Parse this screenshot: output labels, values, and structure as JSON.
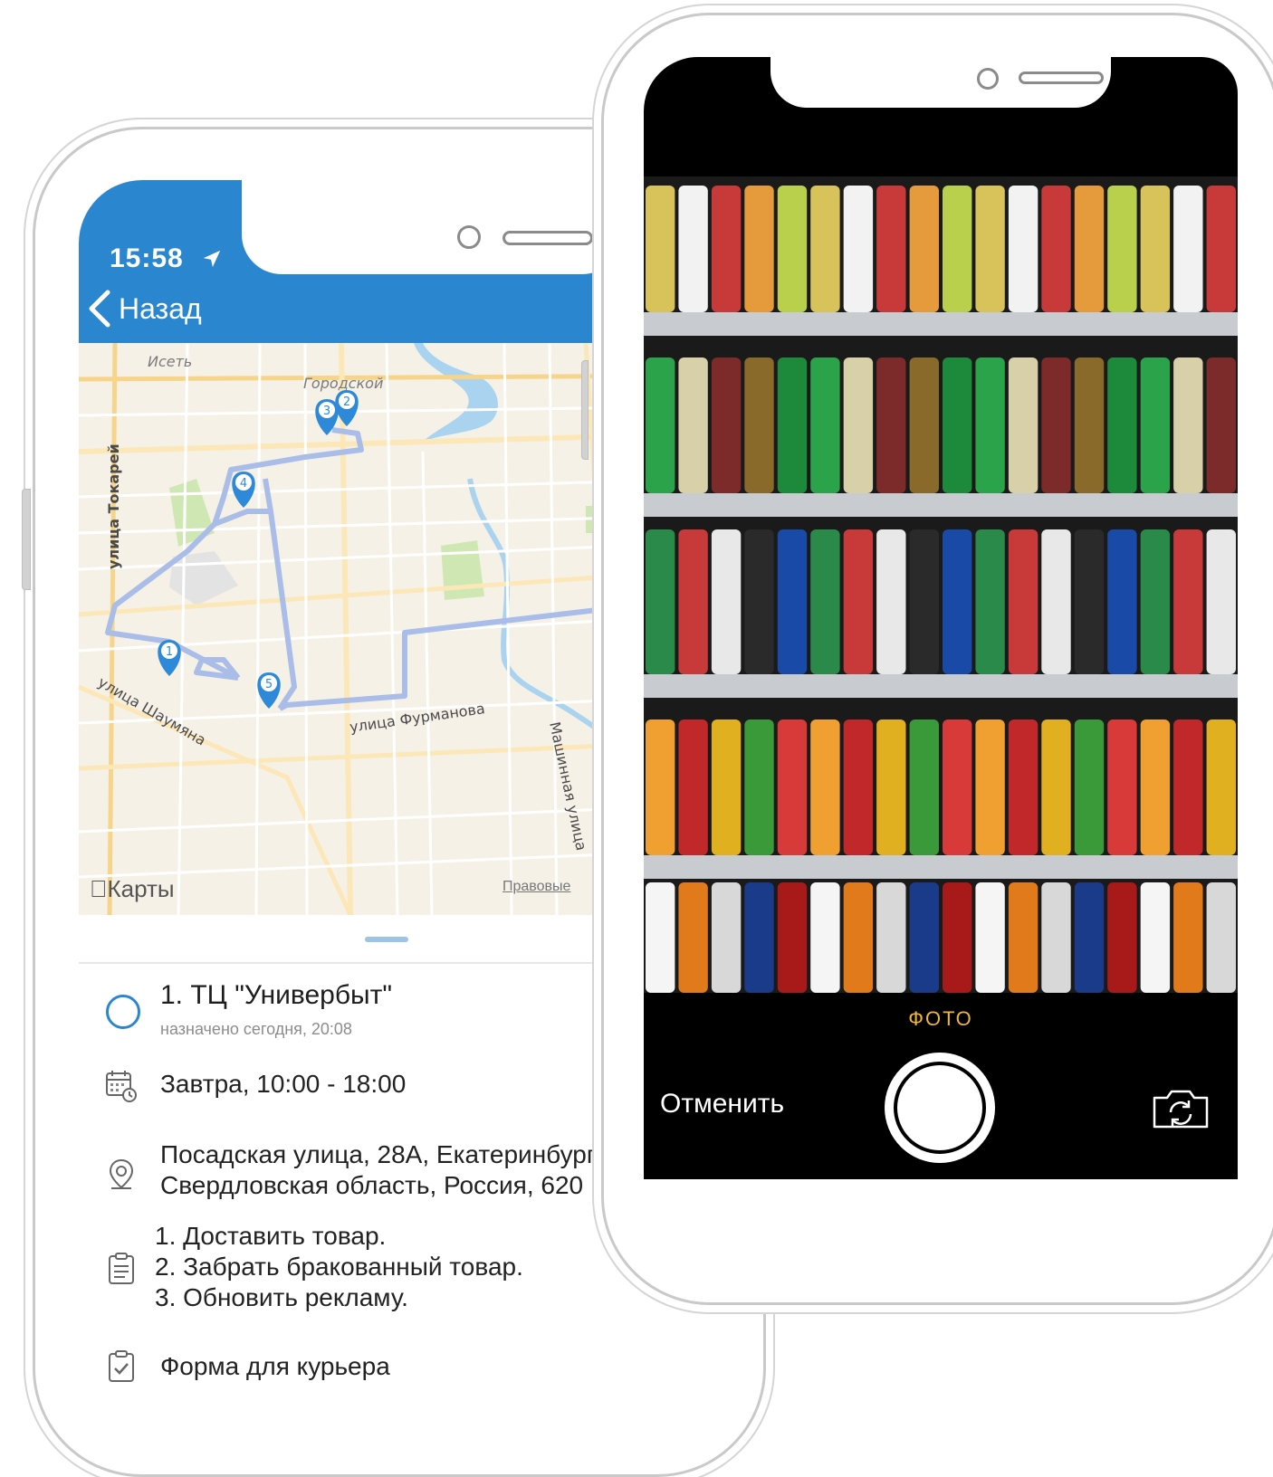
{
  "left_phone": {
    "status": {
      "time": "15:58"
    },
    "nav": {
      "back_label": "Назад"
    },
    "map": {
      "labels": {
        "iset": "Исеть",
        "gorod": "Городской",
        "tokarey": "улица Токарей",
        "shaumyana": "улица Шаумяна",
        "furmanova": "улица Фурманова",
        "mashinnaya": "Машинная улица"
      },
      "markers": [
        "1",
        "2",
        "3",
        "4",
        "5"
      ],
      "logo": "Карты",
      "legal": "Правовые"
    },
    "task": {
      "title": "1. ТЦ \"Универбыт\"",
      "subtitle": "назначено сегодня, 20:08",
      "schedule": "Завтра, 10:00 - 18:00",
      "address_line1": "Посадская улица, 28А, Екатеринбург,",
      "address_line2": "Свердловская область, Россия, 620",
      "todo": [
        "1. Доставить товар.",
        "2. Забрать бракованный товар.",
        "3. Обновить рекламу."
      ],
      "form_label": "Форма для курьера"
    },
    "colors": {
      "accent": "#2b86d0",
      "map_bg": "#f6f1e7",
      "route": "#a9bde8"
    },
    "icons": [
      "location-arrow-icon",
      "chevron-left-icon",
      "map-pin-icon",
      "calendar-clock-icon",
      "location-pin-icon",
      "clipboard-list-icon",
      "clipboard-check-icon"
    ]
  },
  "right_phone": {
    "camera": {
      "mode_label": "ФОТО",
      "cancel_label": "Отменить"
    },
    "colors": {
      "mode_label": "#f0b53a",
      "screen_bg": "#000000"
    },
    "icons": [
      "shutter-button-icon",
      "camera-flip-icon"
    ]
  }
}
